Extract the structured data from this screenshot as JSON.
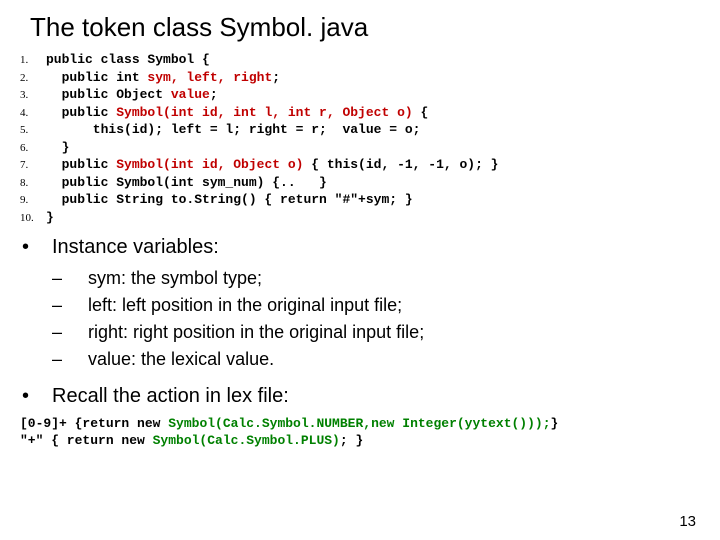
{
  "title": "The token class Symbol. java",
  "code": {
    "l1": "public class Symbol {",
    "l2a": "  public int ",
    "l2b": "sym, left, right",
    "l2c": ";",
    "l3a": "  public Object ",
    "l3b": "value",
    "l3c": ";",
    "l4a": "  public ",
    "l4b": "Symbol(int id, int l, int r, Object o)",
    "l4c": " {",
    "l5": "      this(id); left = l; right = r;  value = o;",
    "l6": "  }",
    "l7a": "  public ",
    "l7b": "Symbol(int id, Object o)",
    "l7c": " { this(id, -1, -1, o); }",
    "l8": "  public Symbol(int sym_num) {..   }",
    "l9": "  public String to.String() { return \"#\"+sym; }",
    "l10": "}"
  },
  "bullet1": "Instance variables:",
  "sub": {
    "a": "sym: the symbol type;",
    "b": "left: left position in the original input file;",
    "c": "right: right position in the original input file;",
    "d": "value: the lexical value."
  },
  "bullet2": "Recall the action in lex file:",
  "lex": {
    "l1a": "[0-9]+ {return new ",
    "l1b": "Symbol(Calc.Symbol.NUMBER,new Integer(yytext()));",
    "l1c": "}",
    "l2a": "\"+\" { return new ",
    "l2b": "Symbol(Calc.Symbol.PLUS)",
    "l2c": "; }"
  },
  "pagenum": "13"
}
